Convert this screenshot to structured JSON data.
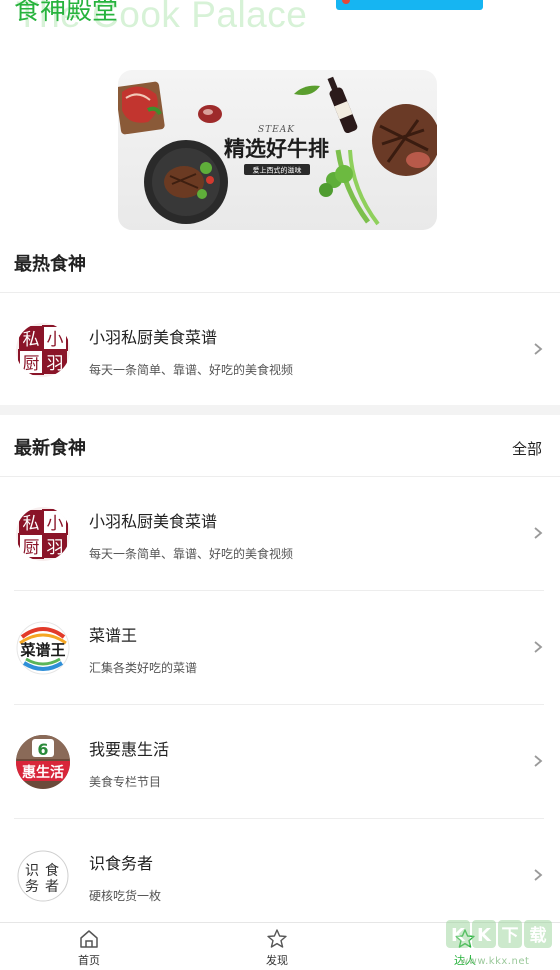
{
  "header": {
    "brand_cn": "食神殿堂",
    "brand_en": "The Cook Palace",
    "accent_color": "#27b33d"
  },
  "banner": {
    "steak_word": "STEAK",
    "headline": "精选好牛排",
    "tagline": "爱上西式的滋味"
  },
  "hot_section": {
    "title": "最热食神",
    "items": [
      {
        "title": "小羽私厨美食菜谱",
        "desc": "每天一条简单、靠谱、好吃的美食视频",
        "avatar": "xiaoyu-logo"
      }
    ]
  },
  "new_section": {
    "title": "最新食神",
    "more_label": "全部",
    "items": [
      {
        "title": "小羽私厨美食菜谱",
        "desc": "每天一条简单、靠谱、好吃的美食视频",
        "avatar": "xiaoyu-logo"
      },
      {
        "title": "菜谱王",
        "desc": "汇集各类好吃的菜谱",
        "avatar": "caipuwang-logo"
      },
      {
        "title": "我要惠生活",
        "desc": "美食专栏节目",
        "avatar": "huishenghuo-logo"
      },
      {
        "title": "识食务者",
        "desc": "硬核吃货一枚",
        "avatar": "shishiwuzhe-logo"
      }
    ]
  },
  "tabbar": {
    "tabs": [
      {
        "label": "首页",
        "icon": "home-icon"
      },
      {
        "label": "发现",
        "icon": "star-outline-icon"
      },
      {
        "label": "达人",
        "icon": "star-active-icon",
        "active": true
      }
    ]
  },
  "watermark": {
    "text": "KK下载",
    "url": "www.kkx.net"
  }
}
